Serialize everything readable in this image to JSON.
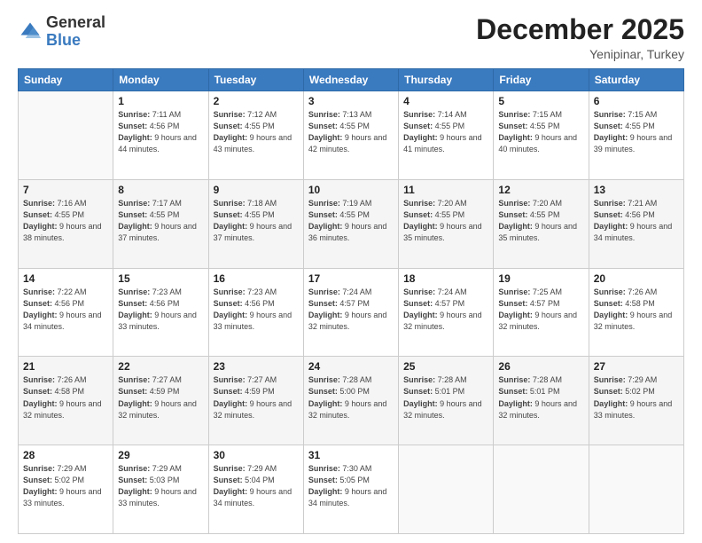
{
  "logo": {
    "general": "General",
    "blue": "Blue"
  },
  "header": {
    "month": "December 2025",
    "location": "Yenipinar, Turkey"
  },
  "days_of_week": [
    "Sunday",
    "Monday",
    "Tuesday",
    "Wednesday",
    "Thursday",
    "Friday",
    "Saturday"
  ],
  "weeks": [
    [
      {
        "num": "",
        "sunrise": "",
        "sunset": "",
        "daylight": "",
        "empty": true
      },
      {
        "num": "1",
        "sunrise": "7:11 AM",
        "sunset": "4:56 PM",
        "daylight": "9 hours and 44 minutes.",
        "empty": false
      },
      {
        "num": "2",
        "sunrise": "7:12 AM",
        "sunset": "4:55 PM",
        "daylight": "9 hours and 43 minutes.",
        "empty": false
      },
      {
        "num": "3",
        "sunrise": "7:13 AM",
        "sunset": "4:55 PM",
        "daylight": "9 hours and 42 minutes.",
        "empty": false
      },
      {
        "num": "4",
        "sunrise": "7:14 AM",
        "sunset": "4:55 PM",
        "daylight": "9 hours and 41 minutes.",
        "empty": false
      },
      {
        "num": "5",
        "sunrise": "7:15 AM",
        "sunset": "4:55 PM",
        "daylight": "9 hours and 40 minutes.",
        "empty": false
      },
      {
        "num": "6",
        "sunrise": "7:15 AM",
        "sunset": "4:55 PM",
        "daylight": "9 hours and 39 minutes.",
        "empty": false
      }
    ],
    [
      {
        "num": "7",
        "sunrise": "7:16 AM",
        "sunset": "4:55 PM",
        "daylight": "9 hours and 38 minutes.",
        "empty": false
      },
      {
        "num": "8",
        "sunrise": "7:17 AM",
        "sunset": "4:55 PM",
        "daylight": "9 hours and 37 minutes.",
        "empty": false
      },
      {
        "num": "9",
        "sunrise": "7:18 AM",
        "sunset": "4:55 PM",
        "daylight": "9 hours and 37 minutes.",
        "empty": false
      },
      {
        "num": "10",
        "sunrise": "7:19 AM",
        "sunset": "4:55 PM",
        "daylight": "9 hours and 36 minutes.",
        "empty": false
      },
      {
        "num": "11",
        "sunrise": "7:20 AM",
        "sunset": "4:55 PM",
        "daylight": "9 hours and 35 minutes.",
        "empty": false
      },
      {
        "num": "12",
        "sunrise": "7:20 AM",
        "sunset": "4:55 PM",
        "daylight": "9 hours and 35 minutes.",
        "empty": false
      },
      {
        "num": "13",
        "sunrise": "7:21 AM",
        "sunset": "4:56 PM",
        "daylight": "9 hours and 34 minutes.",
        "empty": false
      }
    ],
    [
      {
        "num": "14",
        "sunrise": "7:22 AM",
        "sunset": "4:56 PM",
        "daylight": "9 hours and 34 minutes.",
        "empty": false
      },
      {
        "num": "15",
        "sunrise": "7:23 AM",
        "sunset": "4:56 PM",
        "daylight": "9 hours and 33 minutes.",
        "empty": false
      },
      {
        "num": "16",
        "sunrise": "7:23 AM",
        "sunset": "4:56 PM",
        "daylight": "9 hours and 33 minutes.",
        "empty": false
      },
      {
        "num": "17",
        "sunrise": "7:24 AM",
        "sunset": "4:57 PM",
        "daylight": "9 hours and 32 minutes.",
        "empty": false
      },
      {
        "num": "18",
        "sunrise": "7:24 AM",
        "sunset": "4:57 PM",
        "daylight": "9 hours and 32 minutes.",
        "empty": false
      },
      {
        "num": "19",
        "sunrise": "7:25 AM",
        "sunset": "4:57 PM",
        "daylight": "9 hours and 32 minutes.",
        "empty": false
      },
      {
        "num": "20",
        "sunrise": "7:26 AM",
        "sunset": "4:58 PM",
        "daylight": "9 hours and 32 minutes.",
        "empty": false
      }
    ],
    [
      {
        "num": "21",
        "sunrise": "7:26 AM",
        "sunset": "4:58 PM",
        "daylight": "9 hours and 32 minutes.",
        "empty": false
      },
      {
        "num": "22",
        "sunrise": "7:27 AM",
        "sunset": "4:59 PM",
        "daylight": "9 hours and 32 minutes.",
        "empty": false
      },
      {
        "num": "23",
        "sunrise": "7:27 AM",
        "sunset": "4:59 PM",
        "daylight": "9 hours and 32 minutes.",
        "empty": false
      },
      {
        "num": "24",
        "sunrise": "7:28 AM",
        "sunset": "5:00 PM",
        "daylight": "9 hours and 32 minutes.",
        "empty": false
      },
      {
        "num": "25",
        "sunrise": "7:28 AM",
        "sunset": "5:01 PM",
        "daylight": "9 hours and 32 minutes.",
        "empty": false
      },
      {
        "num": "26",
        "sunrise": "7:28 AM",
        "sunset": "5:01 PM",
        "daylight": "9 hours and 32 minutes.",
        "empty": false
      },
      {
        "num": "27",
        "sunrise": "7:29 AM",
        "sunset": "5:02 PM",
        "daylight": "9 hours and 33 minutes.",
        "empty": false
      }
    ],
    [
      {
        "num": "28",
        "sunrise": "7:29 AM",
        "sunset": "5:02 PM",
        "daylight": "9 hours and 33 minutes.",
        "empty": false
      },
      {
        "num": "29",
        "sunrise": "7:29 AM",
        "sunset": "5:03 PM",
        "daylight": "9 hours and 33 minutes.",
        "empty": false
      },
      {
        "num": "30",
        "sunrise": "7:29 AM",
        "sunset": "5:04 PM",
        "daylight": "9 hours and 34 minutes.",
        "empty": false
      },
      {
        "num": "31",
        "sunrise": "7:30 AM",
        "sunset": "5:05 PM",
        "daylight": "9 hours and 34 minutes.",
        "empty": false
      },
      {
        "num": "",
        "sunrise": "",
        "sunset": "",
        "daylight": "",
        "empty": true
      },
      {
        "num": "",
        "sunrise": "",
        "sunset": "",
        "daylight": "",
        "empty": true
      },
      {
        "num": "",
        "sunrise": "",
        "sunset": "",
        "daylight": "",
        "empty": true
      }
    ]
  ],
  "labels": {
    "sunrise": "Sunrise:",
    "sunset": "Sunset:",
    "daylight": "Daylight:"
  }
}
